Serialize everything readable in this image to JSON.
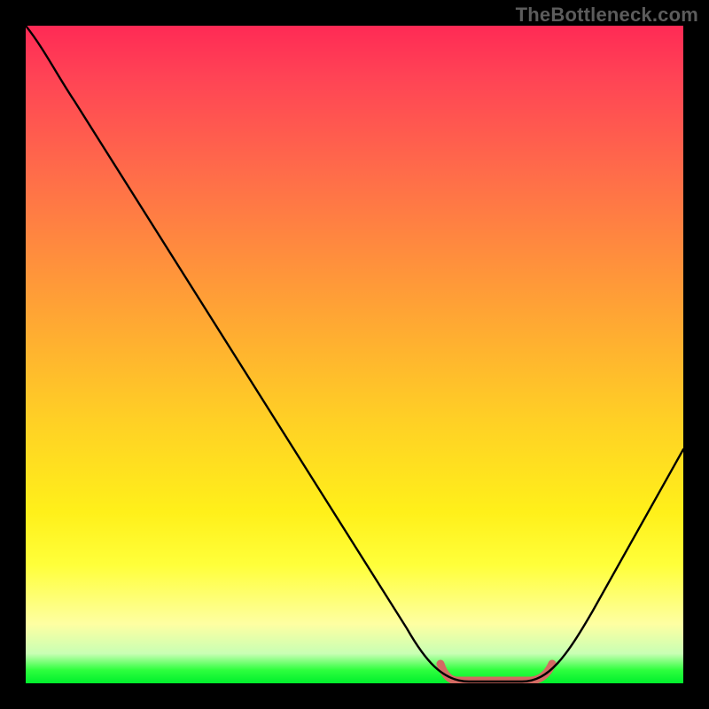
{
  "watermark": "TheBottleneck.com",
  "chart_data": {
    "type": "line",
    "title": "",
    "xlabel": "",
    "ylabel": "",
    "xlim": [
      0,
      100
    ],
    "ylim": [
      0,
      100
    ],
    "x": [
      0,
      6,
      12,
      18,
      24,
      30,
      36,
      42,
      48,
      54,
      60,
      63,
      66,
      69,
      72,
      75,
      78,
      82,
      86,
      90,
      94,
      100
    ],
    "values": [
      100,
      95,
      86,
      77,
      68,
      59,
      50,
      41,
      32,
      23,
      14,
      9,
      4,
      1,
      0,
      0,
      0,
      1,
      6,
      14,
      23,
      40
    ],
    "series": [
      {
        "name": "bottleneck-curve",
        "color": "#000000"
      }
    ],
    "flat_region": {
      "x_start": 63,
      "x_end": 80,
      "y": 0,
      "color": "#d46a63"
    }
  }
}
